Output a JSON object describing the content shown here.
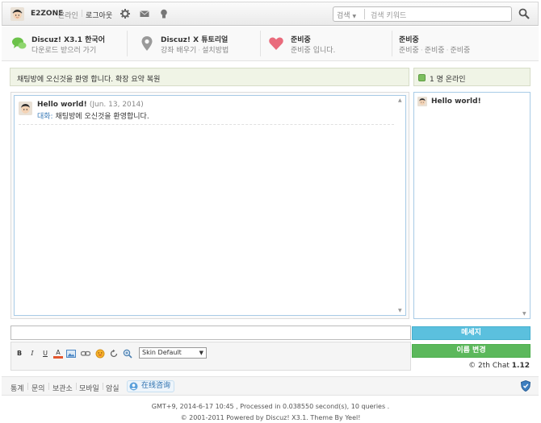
{
  "topbar": {
    "username": "E2ZONE",
    "status": "온라인",
    "logout": "로그아웃",
    "search_select": "검색",
    "search_placeholder": "검색 키워드"
  },
  "intro": [
    {
      "title": "Discuz! X3.1 한국어",
      "subs": [
        "다운로드 받으러 가기"
      ],
      "icon": "chat-bubbles-icon",
      "color": "#6cc24a"
    },
    {
      "title": "Discuz! X 튜토리얼",
      "subs": [
        "강좌 배우기",
        "설치방법"
      ],
      "icon": "map-pin-icon",
      "color": "#999999"
    },
    {
      "title": "준비중",
      "subs": [
        "준비중 입니다."
      ],
      "icon": "heart-icon",
      "color": "#e96b7c"
    },
    {
      "title": "준비중",
      "subs": [
        "준비중",
        "준비중",
        "준비중"
      ],
      "icon": "",
      "color": ""
    }
  ],
  "chat": {
    "notice": "채팅방에 오신것을 환영 합니다. 확장 요약 복원",
    "online_text": "1 명 온라인",
    "messages": [
      {
        "name": "Hello world!",
        "date": "(Jun. 13, 2014)",
        "who": "대화:",
        "text": "채팅방에 오신것을 환영합니다."
      }
    ],
    "users": [
      {
        "name": "Hello world!"
      }
    ],
    "send_label": "메세지",
    "rename_label": "이름 변경",
    "skin_value": "Skin Default",
    "copyright_prefix": "© 2th Chat",
    "copyright_version": "1.12"
  },
  "footer": {
    "links": [
      "통계",
      "문의",
      "보관소",
      "모바일",
      "암실"
    ],
    "zxzx": "在线咨询"
  },
  "bottom": {
    "gmt": "GMT+9, 2014-6-17 10:45 , Processed in 0.038550 second(s), 10 queries .",
    "powered": "© 2001-2011 Powered by Discuz! X3.1. Theme By Yeel!"
  },
  "colors": {
    "send": "#5bc0de",
    "rename": "#5cb85c"
  }
}
